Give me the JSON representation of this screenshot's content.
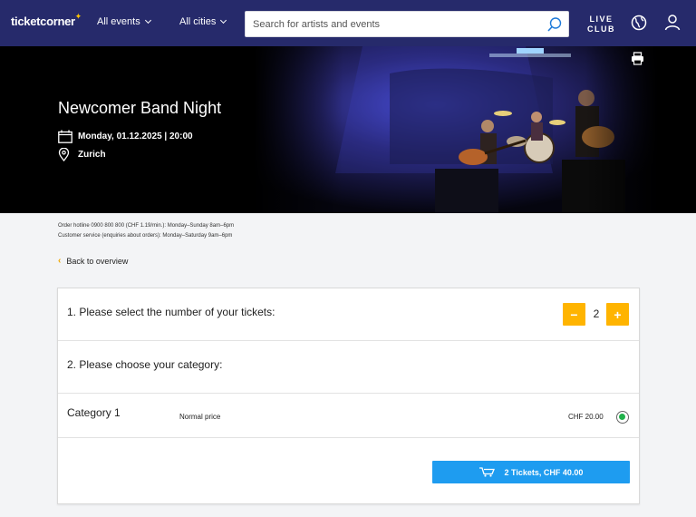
{
  "header": {
    "logo": "ticketcorner",
    "nav": [
      "All events",
      "All cities"
    ],
    "search_placeholder": "Search for artists and events",
    "live_line1": "LIVE",
    "live_line2": "CLUB"
  },
  "hero": {
    "title": "Newcomer Band Night",
    "date": "Monday, 01.12.2025 | 20:00",
    "location": "Zurich"
  },
  "info": {
    "hotline": "Order hotline 0900 800 800 (CHF 1.19/min.): Monday–Sunday 8am–6pm",
    "service": "Customer service (enquiries about orders): Monday–Saturday 9am–6pm"
  },
  "back_label": "Back to overview",
  "tickets": {
    "step1": "1. Please select the number of your tickets:",
    "minus": "−",
    "plus": "+",
    "quantity": "2",
    "step2": "2. Please choose your category:"
  },
  "category": {
    "name": "Category 1",
    "price_type": "Normal price",
    "price": "CHF 20.00"
  },
  "buy_label": "2 Tickets, CHF 40.00",
  "colors": {
    "header": "#262a6b",
    "accent": "#ffb400",
    "buy": "#1e9cf0",
    "radio": "#20b14a"
  }
}
